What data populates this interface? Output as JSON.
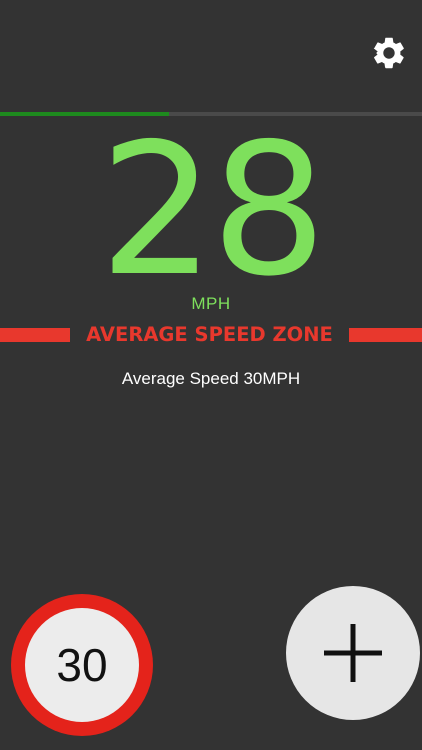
{
  "settings": {
    "icon": "gear-icon"
  },
  "progress": {
    "fraction": 0.4
  },
  "speed": {
    "value": "28",
    "unit": "MPH"
  },
  "zone": {
    "label": "AVERAGE SPEED ZONE"
  },
  "average": {
    "text": "Average Speed 30MPH"
  },
  "limit": {
    "value": "30"
  },
  "add": {
    "icon": "plus-icon"
  },
  "colors": {
    "background": "#333333",
    "speed": "#7ee05c",
    "zone": "#e8382d",
    "progress": "#1e8a1e",
    "sign_ring": "#e4231b"
  }
}
